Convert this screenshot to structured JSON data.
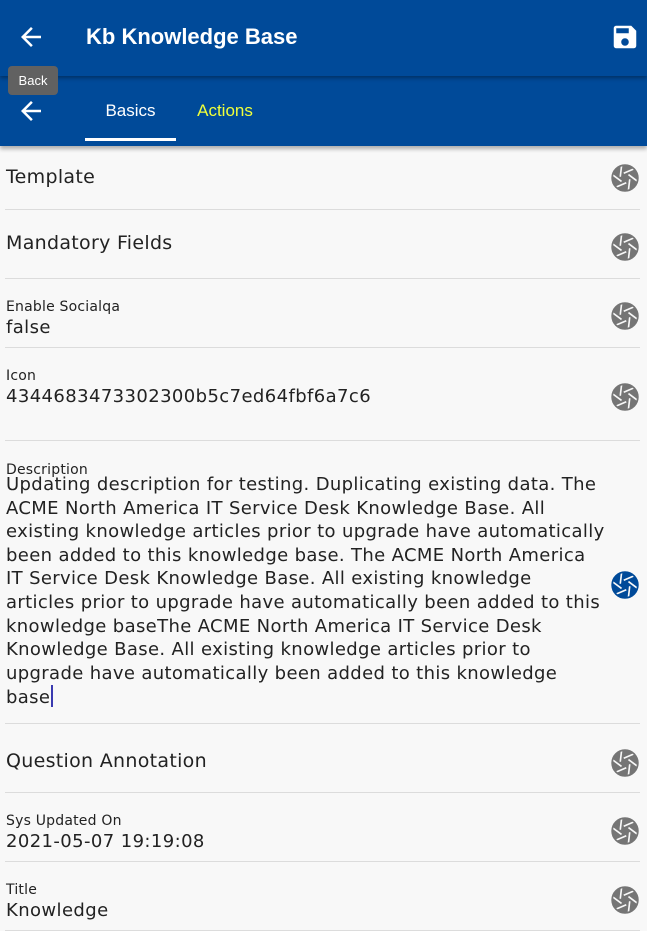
{
  "header": {
    "title": "Kb Knowledge Base",
    "back_icon": "arrow-left-icon",
    "save_icon": "save-icon",
    "background": "#004a99"
  },
  "tooltip": {
    "text": "Back"
  },
  "tabs": [
    {
      "label": "Basics",
      "active": true,
      "color": "#ffffff"
    },
    {
      "label": "Actions",
      "active": false,
      "color": "#f0ff3a"
    }
  ],
  "fields": {
    "template": {
      "label": "Template"
    },
    "mandatory": {
      "label": "Mandatory Fields"
    },
    "socialqa": {
      "label": "Enable Socialqa",
      "value": "false"
    },
    "icon": {
      "label": "Icon",
      "value": "4344683473302300b5c7ed64fbf6a7c6"
    },
    "description": {
      "label": "Description",
      "value": "Updating description for testing. Duplicating existing data. The ACME North America IT Service Desk Knowledge Base. All existing knowledge articles prior to upgrade have automatically been added to this knowledge base. The ACME North America IT Service Desk Knowledge Base. All existing knowledge articles prior to upgrade have automatically been added to this knowledge baseThe ACME North America IT Service Desk Knowledge Base. All existing knowledge articles prior to upgrade have automatically been added to this knowledge base"
    },
    "question_annotation": {
      "label": "Question Annotation"
    },
    "sys_updated_on": {
      "label": "Sys Updated On",
      "value": "2021-05-07 19:19:08"
    },
    "title": {
      "label": "Title",
      "value": "Knowledge"
    }
  },
  "row_icon": "aperture-icon",
  "colors": {
    "icon_inactive": "#757575",
    "icon_active": "#004a99",
    "caret": "#3a3ab0"
  }
}
